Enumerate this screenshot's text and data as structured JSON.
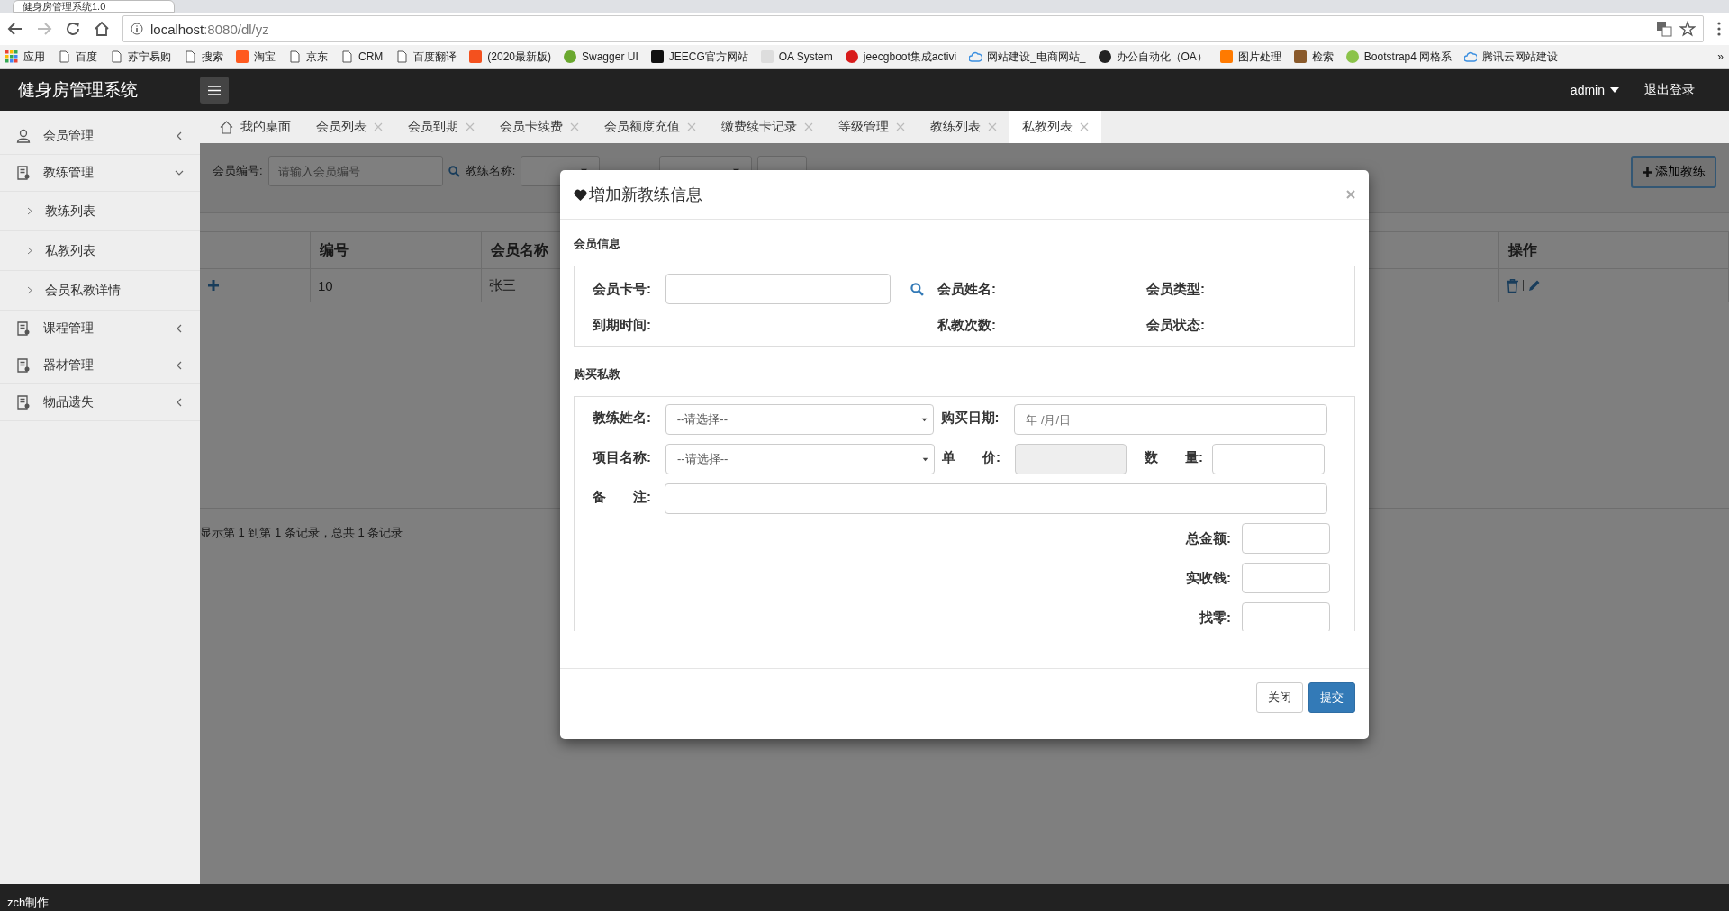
{
  "browser": {
    "tab_title": "健身房管理系统1.0",
    "url_host": "localhost",
    "url_path": ":8080/dl/yz",
    "bookmarks": [
      {
        "label": "应用",
        "kind": "apps"
      },
      {
        "label": "百度",
        "kind": "page"
      },
      {
        "label": "苏宁易购",
        "kind": "page"
      },
      {
        "label": "搜索",
        "kind": "page"
      },
      {
        "label": "淘宝",
        "kind": "badge",
        "color": "#ff5a1f"
      },
      {
        "label": "京东",
        "kind": "page"
      },
      {
        "label": "CRM",
        "kind": "page"
      },
      {
        "label": "百度翻译",
        "kind": "page"
      },
      {
        "label": "(2020最新版)",
        "kind": "badge",
        "color": "#f4511e"
      },
      {
        "label": "Swagger UI",
        "kind": "dot",
        "color": "#6aa82f"
      },
      {
        "label": "JEECG官方网站",
        "kind": "badge",
        "color": "#111111"
      },
      {
        "label": "OA System",
        "kind": "badge",
        "color": "#dddddd"
      },
      {
        "label": "jeecgboot集成activi",
        "kind": "dot",
        "color": "#d81b1b"
      },
      {
        "label": "网站建设_电商网站_",
        "kind": "cloud",
        "color": "#3b8fe0"
      },
      {
        "label": "办公自动化（OA）",
        "kind": "dot",
        "color": "#222222"
      },
      {
        "label": "图片处理",
        "kind": "badge",
        "color": "#ff7a00"
      },
      {
        "label": "检索",
        "kind": "badge",
        "color": "#8a5a2b"
      },
      {
        "label": "Bootstrap4 网格系",
        "kind": "dot",
        "color": "#8bc34a"
      },
      {
        "label": "腾讯云网站建设",
        "kind": "cloud",
        "color": "#3b8fe0"
      }
    ],
    "overflow": "»"
  },
  "header": {
    "title": "健身房管理系统",
    "user": "admin",
    "logout": "退出登录"
  },
  "sidebar": {
    "items": [
      {
        "label": "会员管理",
        "kind": "person",
        "expanded": false
      },
      {
        "label": "教练管理",
        "kind": "form",
        "expanded": true,
        "children": [
          {
            "label": "教练列表"
          },
          {
            "label": "私教列表"
          },
          {
            "label": "会员私教详情"
          }
        ]
      },
      {
        "label": "课程管理",
        "kind": "form",
        "expanded": false
      },
      {
        "label": "器材管理",
        "kind": "form",
        "expanded": false
      },
      {
        "label": "物品遗失",
        "kind": "form",
        "expanded": false
      }
    ]
  },
  "tabs": [
    {
      "label": "我的桌面",
      "kind": "home",
      "selected": false
    },
    {
      "label": "会员列表",
      "kind": "page",
      "selected": false
    },
    {
      "label": "会员到期",
      "kind": "page",
      "selected": false
    },
    {
      "label": "会员卡续费",
      "kind": "page",
      "selected": false
    },
    {
      "label": "会员额度充值",
      "kind": "page",
      "selected": false
    },
    {
      "label": "缴费续卡记录",
      "kind": "page",
      "selected": false
    },
    {
      "label": "等级管理",
      "kind": "page",
      "selected": false
    },
    {
      "label": "教练列表",
      "kind": "page",
      "selected": false
    },
    {
      "label": "私教列表",
      "kind": "page",
      "selected": true
    }
  ],
  "filter": {
    "member_label": "会员编号:",
    "member_placeholder": "请输入会员编号",
    "coach_label": "教练名称:",
    "add_button": "添加教练"
  },
  "table": {
    "columns": [
      {
        "label": "编号",
        "kind": "text"
      },
      {
        "label": "会员名称",
        "kind": "text"
      },
      {
        "label": "操作",
        "kind": "actions"
      }
    ],
    "rows": [
      {
        "cells": [
          "10",
          "张三"
        ]
      }
    ],
    "pagination": "显示第 1 到第 1 条记录，总共 1 条记录"
  },
  "modal": {
    "title": "增加新教练信息",
    "member_section": {
      "title": "会员信息",
      "card_label": "会员卡号:",
      "fields": [
        "会员姓名:",
        "会员类型:",
        "到期时间:",
        "私教次数:",
        "会员状态:"
      ]
    },
    "purchase_section": {
      "title": "购买私教",
      "coach": {
        "label": "教练姓名:",
        "value": "--请选择--"
      },
      "date": {
        "label": "购买日期:",
        "placeholder": "年 /月/日"
      },
      "item": {
        "label": "项目名称:",
        "value": "--请选择--"
      },
      "price": {
        "label": "单　　价:",
        "disabled": true
      },
      "quantity": {
        "label": "数　　量:"
      },
      "remark": {
        "label": "备　　注:"
      },
      "totals": [
        "总金额:",
        "实收钱:",
        "找零:"
      ]
    },
    "buttons": [
      {
        "label": "关闭",
        "kind": "default"
      },
      {
        "label": "提交",
        "kind": "primary"
      }
    ]
  },
  "footer": {
    "text": "zch制作"
  }
}
